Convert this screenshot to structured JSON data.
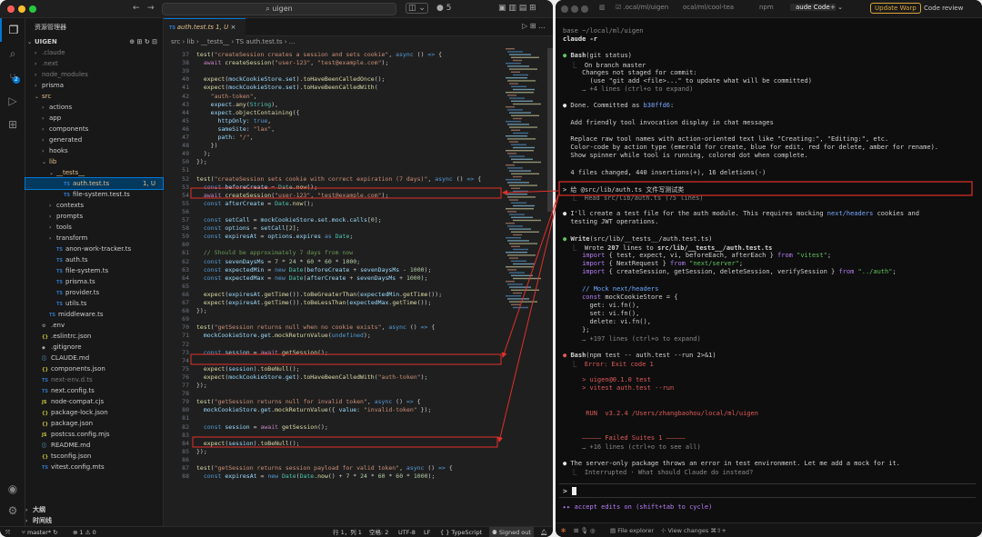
{
  "vscode": {
    "search": "uigen",
    "badge_count": "5",
    "explorer_title": "资源管理器",
    "root": "UIGEN",
    "tree": [
      {
        "label": ".claude",
        "indent": 1,
        "arrow": "›",
        "icon": "",
        "cls": "dim"
      },
      {
        "label": ".next",
        "indent": 1,
        "arrow": "›",
        "icon": "",
        "cls": "dim"
      },
      {
        "label": "node_modules",
        "indent": 1,
        "arrow": "›",
        "icon": "",
        "cls": "dim"
      },
      {
        "label": "prisma",
        "indent": 1,
        "arrow": "›",
        "icon": "",
        "cls": ""
      },
      {
        "label": "src",
        "indent": 1,
        "arrow": "⌄",
        "icon": "",
        "cls": "red"
      },
      {
        "label": "actions",
        "indent": 2,
        "arrow": "›",
        "icon": "",
        "cls": ""
      },
      {
        "label": "app",
        "indent": 2,
        "arrow": "›",
        "icon": "",
        "cls": ""
      },
      {
        "label": "components",
        "indent": 2,
        "arrow": "›",
        "icon": "",
        "cls": ""
      },
      {
        "label": "generated",
        "indent": 2,
        "arrow": "›",
        "icon": "",
        "cls": ""
      },
      {
        "label": "hooks",
        "indent": 2,
        "arrow": "›",
        "icon": "",
        "cls": ""
      },
      {
        "label": "lib",
        "indent": 2,
        "arrow": "⌄",
        "icon": "",
        "cls": "red"
      },
      {
        "label": "__tests__",
        "indent": 3,
        "arrow": "⌄",
        "icon": "",
        "cls": "red"
      },
      {
        "label": "auth.test.ts",
        "indent": 4,
        "arrow": "",
        "icon": "TS",
        "cls": "sel",
        "tag": "1, U"
      },
      {
        "label": "file-system.test.ts",
        "indent": 4,
        "arrow": "",
        "icon": "TS",
        "cls": ""
      },
      {
        "label": "contexts",
        "indent": 3,
        "arrow": "›",
        "icon": "",
        "cls": ""
      },
      {
        "label": "prompts",
        "indent": 3,
        "arrow": "›",
        "icon": "",
        "cls": ""
      },
      {
        "label": "tools",
        "indent": 3,
        "arrow": "›",
        "icon": "",
        "cls": ""
      },
      {
        "label": "transform",
        "indent": 3,
        "arrow": "›",
        "icon": "",
        "cls": ""
      },
      {
        "label": "anon-work-tracker.ts",
        "indent": 3,
        "arrow": "",
        "icon": "TS",
        "cls": ""
      },
      {
        "label": "auth.ts",
        "indent": 3,
        "arrow": "",
        "icon": "TS",
        "cls": ""
      },
      {
        "label": "file-system.ts",
        "indent": 3,
        "arrow": "",
        "icon": "TS",
        "cls": ""
      },
      {
        "label": "prisma.ts",
        "indent": 3,
        "arrow": "",
        "icon": "TS",
        "cls": ""
      },
      {
        "label": "provider.ts",
        "indent": 3,
        "arrow": "",
        "icon": "TS",
        "cls": ""
      },
      {
        "label": "utils.ts",
        "indent": 3,
        "arrow": "",
        "icon": "TS",
        "cls": ""
      },
      {
        "label": "middleware.ts",
        "indent": 2,
        "arrow": "",
        "icon": "TS",
        "cls": ""
      },
      {
        "label": ".env",
        "indent": 1,
        "arrow": "",
        "icon": "⚙",
        "cls": ""
      },
      {
        "label": ".eslintrc.json",
        "indent": 1,
        "arrow": "",
        "icon": "{}",
        "cls": ""
      },
      {
        "label": ".gitignore",
        "indent": 1,
        "arrow": "",
        "icon": "◆",
        "cls": ""
      },
      {
        "label": "CLAUDE.md",
        "indent": 1,
        "arrow": "",
        "icon": "ⓘ",
        "cls": ""
      },
      {
        "label": "components.json",
        "indent": 1,
        "arrow": "",
        "icon": "{}",
        "cls": ""
      },
      {
        "label": "next-env.d.ts",
        "indent": 1,
        "arrow": "",
        "icon": "TS",
        "cls": "dim"
      },
      {
        "label": "next.config.ts",
        "indent": 1,
        "arrow": "",
        "icon": "TS",
        "cls": ""
      },
      {
        "label": "node-compat.cjs",
        "indent": 1,
        "arrow": "",
        "icon": "JS",
        "cls": ""
      },
      {
        "label": "package-lock.json",
        "indent": 1,
        "arrow": "",
        "icon": "{}",
        "cls": ""
      },
      {
        "label": "package.json",
        "indent": 1,
        "arrow": "",
        "icon": "{}",
        "cls": ""
      },
      {
        "label": "postcss.config.mjs",
        "indent": 1,
        "arrow": "",
        "icon": "JS",
        "cls": ""
      },
      {
        "label": "README.md",
        "indent": 1,
        "arrow": "",
        "icon": "ⓘ",
        "cls": ""
      },
      {
        "label": "tsconfig.json",
        "indent": 1,
        "arrow": "",
        "icon": "{}",
        "cls": ""
      },
      {
        "label": "vitest.config.mts",
        "indent": 1,
        "arrow": "",
        "icon": "TS",
        "cls": ""
      }
    ],
    "outline": "大纲",
    "timeline": "时间线",
    "tab_label": "auth.test.ts 1, U",
    "breadcrumb": "src › lib › __tests__ › TS auth.test.ts › ...",
    "status": {
      "branch": "master*",
      "problems": "⊗ 1 ⚠ 0",
      "position": "行 1，列 1",
      "spaces": "空格: 2",
      "encoding": "UTF-8",
      "eol": "LF",
      "lang": "{ } TypeScript",
      "signed": "Signed out"
    }
  },
  "code_lines": [
    {
      "n": "37",
      "h": "<span class='f'>test</span>(<span class='s'>\"createSession creates a session and sets cookie\"</span>, <span class='k'>async</span> () <span class='k'>=></span> {"
    },
    {
      "n": "38",
      "h": "  <span class='p'>await</span> <span class='f'>createSession</span>(<span class='s'>\"user-123\"</span>, <span class='s'>\"test@example.com\"</span>);"
    },
    {
      "n": "39",
      "h": ""
    },
    {
      "n": "40",
      "h": "  <span class='f'>expect</span>(<span class='v'>mockCookieStore</span>.<span class='v'>set</span>).<span class='f'>toHaveBeenCalledOnce</span>();"
    },
    {
      "n": "41",
      "h": "  <span class='f'>expect</span>(<span class='v'>mockCookieStore</span>.<span class='v'>set</span>).<span class='f'>toHaveBeenCalledWith</span>("
    },
    {
      "n": "42",
      "h": "    <span class='s'>\"auth-token\"</span>,"
    },
    {
      "n": "43",
      "h": "    <span class='v'>expect</span>.<span class='f'>any</span>(<span class='t'>String</span>),"
    },
    {
      "n": "44",
      "h": "    <span class='v'>expect</span>.<span class='f'>objectContaining</span>({"
    },
    {
      "n": "45",
      "h": "      <span class='v'>httpOnly</span>: <span class='k'>true</span>,"
    },
    {
      "n": "46",
      "h": "      <span class='v'>sameSite</span>: <span class='s'>\"lax\"</span>,"
    },
    {
      "n": "47",
      "h": "      <span class='v'>path</span>: <span class='s'>\"/\"</span>,"
    },
    {
      "n": "48",
      "h": "    })"
    },
    {
      "n": "49",
      "h": "  );"
    },
    {
      "n": "50",
      "h": "});"
    },
    {
      "n": "51",
      "h": ""
    },
    {
      "n": "52",
      "h": "<span class='f'>test</span>(<span class='s'>\"createSession sets cookie with correct expiration (7 days)\"</span>, <span class='k'>async</span> () <span class='k'>=></span> {"
    },
    {
      "n": "53",
      "h": "  <span class='k'>const</span> <span class='v'>beforeCreate</span> = <span class='t'>Date</span>.<span class='f'>now</span>();"
    },
    {
      "n": "54",
      "h": "  <span class='p'>await</span> <span class='f'>createSession</span>(<span class='s'>\"user-123\"</span>, <span class='s'>\"test@example.com\"</span>);"
    },
    {
      "n": "55",
      "h": "  <span class='k'>const</span> <span class='v'>afterCreate</span> = <span class='t'>Date</span>.<span class='f'>now</span>();"
    },
    {
      "n": "56",
      "h": ""
    },
    {
      "n": "57",
      "h": "  <span class='k'>const</span> <span class='v'>setCall</span> = <span class='v'>mockCookieStore</span>.<span class='v'>set</span>.<span class='v'>mock</span>.<span class='v'>calls</span>[<span class='n'>0</span>];"
    },
    {
      "n": "58",
      "h": "  <span class='k'>const</span> <span class='v'>options</span> = <span class='v'>setCall</span>[<span class='n'>2</span>];"
    },
    {
      "n": "59",
      "h": "  <span class='k'>const</span> <span class='v'>expiresAt</span> = <span class='v'>options</span>.<span class='v'>expires</span> <span class='k'>as</span> <span class='t'>Date</span>;"
    },
    {
      "n": "60",
      "h": ""
    },
    {
      "n": "61",
      "h": "  <span class='c'>// Should be approximately 7 days from now</span>"
    },
    {
      "n": "62",
      "h": "  <span class='k'>const</span> <span class='v'>sevenDaysMs</span> = <span class='n'>7</span> * <span class='n'>24</span> * <span class='n'>60</span> * <span class='n'>60</span> * <span class='n'>1000</span>;"
    },
    {
      "n": "63",
      "h": "  <span class='k'>const</span> <span class='v'>expectedMin</span> = <span class='k'>new</span> <span class='t'>Date</span>(<span class='v'>beforeCreate</span> + <span class='v'>sevenDaysMs</span> - <span class='n'>1000</span>);"
    },
    {
      "n": "64",
      "h": "  <span class='k'>const</span> <span class='v'>expectedMax</span> = <span class='k'>new</span> <span class='t'>Date</span>(<span class='v'>afterCreate</span> + <span class='v'>sevenDaysMs</span> + <span class='n'>1000</span>);"
    },
    {
      "n": "65",
      "h": ""
    },
    {
      "n": "66",
      "h": "  <span class='f'>expect</span>(<span class='v'>expiresAt</span>.<span class='f'>getTime</span>()).<span class='f'>toBeGreaterThan</span>(<span class='v'>expectedMin</span>.<span class='f'>getTime</span>());"
    },
    {
      "n": "67",
      "h": "  <span class='f'>expect</span>(<span class='v'>expiresAt</span>.<span class='f'>getTime</span>()).<span class='f'>toBeLessThan</span>(<span class='v'>expectedMax</span>.<span class='f'>getTime</span>());"
    },
    {
      "n": "68",
      "h": "});"
    },
    {
      "n": "69",
      "h": ""
    },
    {
      "n": "70",
      "h": "<span class='f'>test</span>(<span class='s'>\"getSession returns null when no cookie exists\"</span>, <span class='k'>async</span> () <span class='k'>=></span> {"
    },
    {
      "n": "71",
      "h": "  <span class='v'>mockCookieStore</span>.<span class='v'>get</span>.<span class='f'>mockReturnValue</span>(<span class='k'>undefined</span>);"
    },
    {
      "n": "72",
      "h": ""
    },
    {
      "n": "73",
      "h": "  <span class='k'>const</span> <span class='v'>session</span> = <span class='p'>await</span> <span class='f'>getSession</span>();"
    },
    {
      "n": "74",
      "h": ""
    },
    {
      "n": "75",
      "h": "  <span class='f'>expect</span>(<span class='v'>session</span>).<span class='f'>toBeNull</span>();"
    },
    {
      "n": "76",
      "h": "  <span class='f'>expect</span>(<span class='v'>mockCookieStore</span>.<span class='v'>get</span>).<span class='f'>toHaveBeenCalledWith</span>(<span class='s'>\"auth-token\"</span>);"
    },
    {
      "n": "77",
      "h": "});"
    },
    {
      "n": "78",
      "h": ""
    },
    {
      "n": "79",
      "h": "<span class='f'>test</span>(<span class='s'>\"getSession returns null for invalid token\"</span>, <span class='k'>async</span> () <span class='k'>=></span> {"
    },
    {
      "n": "80",
      "h": "  <span class='v'>mockCookieStore</span>.<span class='v'>get</span>.<span class='f'>mockReturnValue</span>({ <span class='v'>value</span>: <span class='s'>\"invalid-token\"</span> });"
    },
    {
      "n": "81",
      "h": ""
    },
    {
      "n": "82",
      "h": "  <span class='k'>const</span> <span class='v'>session</span> = <span class='p'>await</span> <span class='f'>getSession</span>();"
    },
    {
      "n": "83",
      "h": ""
    },
    {
      "n": "84",
      "h": "  <span class='f'>expect</span>(<span class='v'>session</span>).<span class='f'>toBeNull</span>();"
    },
    {
      "n": "85",
      "h": "});"
    },
    {
      "n": "86",
      "h": ""
    },
    {
      "n": "87",
      "h": "<span class='f'>test</span>(<span class='s'>\"getSession returns session payload for valid token\"</span>, <span class='k'>async</span> () <span class='k'>=></span> {"
    },
    {
      "n": "88",
      "h": "  <span class='k'>const</span> <span class='v'>expiresAt</span> = <span class='k'>new</span> <span class='t'>Date</span>(<span class='t'>Date</span>.<span class='f'>now</span>() + <span class='n'>7</span> * <span class='n'>24</span> * <span class='n'>60</span> * <span class='n'>60</span> * <span class='n'>1000</span>);"
    }
  ],
  "terminal": {
    "tabs": [
      ".ocal/ml/uigen",
      "ocal/ml/cool-tea",
      "npm",
      "aude Code"
    ],
    "update": "Update Warp",
    "code_review": "Code review",
    "lines": [
      {
        "h": "<span class='gy'>base ~/local/ml/uigen</span>"
      },
      {
        "h": "<span class='w'><b>claude -r</b></span>"
      },
      {
        "h": ""
      },
      {
        "h": "<span class='g'>●</span> <b>Bash</b>(git status)"
      },
      {
        "h": "  <span class='gy'>⎿</span>  On branch master"
      },
      {
        "h": "     Changes not staged for commit:"
      },
      {
        "h": "       (use \"git add &lt;file&gt;...\" to update what will be committed)"
      },
      {
        "h": "     <span class='gy'>… +4 lines (ctrl+o to expand)</span>"
      },
      {
        "h": ""
      },
      {
        "h": "<span class='w'>●</span> Done. Committed as <span class='bl'>b38ffd6</span>:"
      },
      {
        "h": ""
      },
      {
        "h": "  Add friendly tool invocation display in chat messages"
      },
      {
        "h": ""
      },
      {
        "h": "  Replace raw tool names with action-oriented text like \"Creating:\", \"Editing:\", etc."
      },
      {
        "h": "  Color-code by action type (emerald for create, blue for edit, red for delete, amber for rename)."
      },
      {
        "h": "  Show spinner while tool is running, colored dot when complete."
      },
      {
        "h": ""
      },
      {
        "h": "  4 files changed, 440 insertions(+), 16 deletions(-)"
      },
      {
        "h": ""
      },
      {
        "h": "<span class='w'>&gt;</span> 给 @src/lib/auth.ts 文件写测试类"
      },
      {
        "h": "  <span class='gy'>⎿  Read src/lib/auth.ts (75 lines)</span>"
      },
      {
        "h": ""
      },
      {
        "h": "<span class='w'>●</span> I'll create a test file for the auth module. This requires mocking <span class='bl'>next/headers</span> cookies and"
      },
      {
        "h": "  testing JWT operations."
      },
      {
        "h": ""
      },
      {
        "h": "<span class='g'>●</span> <b>Write</b>(src/lib/__tests__/auth.test.ts)"
      },
      {
        "h": "  <span class='gy'>⎿</span>  Wrote <b>207</b> lines to <b>src/lib/__tests__/auth.test.ts</b>"
      },
      {
        "h": "     <span class='pu'>import</span> { test, expect, vi, beforeEach, afterEach } <span class='pu'>from</span> <span class='g'>\"vitest\"</span>;"
      },
      {
        "h": "     <span class='pu'>import</span> { NextRequest } <span class='pu'>from</span> <span class='g'>\"next/server\"</span>;"
      },
      {
        "h": "     <span class='pu'>import</span> { createSession, getSession, deleteSession, verifySession } <span class='pu'>from</span> <span class='g'>\"../auth\"</span>;"
      },
      {
        "h": ""
      },
      {
        "h": "     <span class='b'>// Mock next/headers</span>"
      },
      {
        "h": "     <span class='pu'>const</span> mockCookieStore = {"
      },
      {
        "h": "       get: vi.fn(),"
      },
      {
        "h": "       set: vi.fn(),"
      },
      {
        "h": "       delete: vi.fn(),"
      },
      {
        "h": "     };"
      },
      {
        "h": "     <span class='gy'>… +197 lines (ctrl+o to expand)</span>"
      },
      {
        "h": ""
      },
      {
        "h": "<span class='r'>●</span> <b>Bash</b>(npm test -- auth.test --run 2&gt;&amp;1)"
      },
      {
        "h": "  <span class='gy'>⎿</span>  <span class='r'>Error: Exit code 1</span>"
      },
      {
        "h": ""
      },
      {
        "h": "     <span class='r'>&gt; uigen@0.1.0 test</span>"
      },
      {
        "h": "     <span class='r'>&gt; vitest auth.test --run</span>"
      },
      {
        "h": ""
      },
      {
        "h": ""
      },
      {
        "h": "      <span class='r'>RUN  v3.2.4 /Users/zhangbaohou/local/ml/uigen</span>"
      },
      {
        "h": ""
      },
      {
        "h": ""
      },
      {
        "h": "     <span class='r'>⎯⎯⎯⎯⎯⎯ Failed Suites 1 ⎯⎯⎯⎯⎯⎯</span>"
      },
      {
        "h": "     <span class='gy'>… +16 lines (ctrl+o to see all)</span>"
      },
      {
        "h": ""
      },
      {
        "h": "<span class='w'>●</span> The server-only package throws an error in test environment. Let me add a mock for it."
      },
      {
        "h": "  <span class='gy'>⎿  Interrupted · What should Claude do instead?</span>"
      }
    ],
    "prompt": ">",
    "accept": "▸▸ accept edits on (shift+tab to cycle)",
    "footer": {
      "explorer": "File explorer",
      "changes": "View changes ⌘⇧+"
    }
  }
}
